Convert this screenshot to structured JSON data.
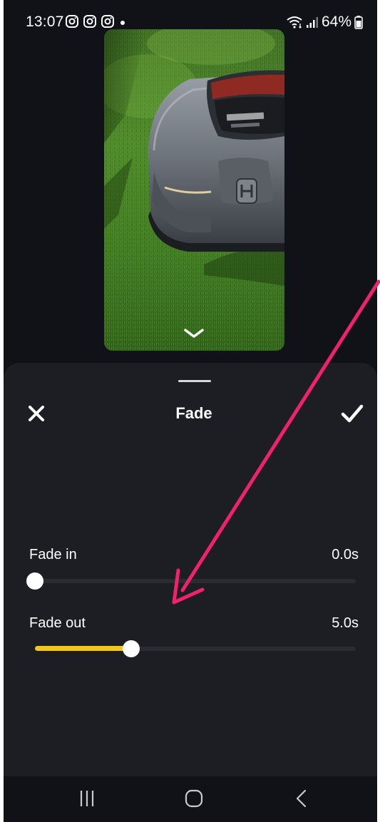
{
  "status_bar": {
    "time": "13:07",
    "battery": "64%",
    "left_icons": [
      "instagram-icon",
      "instagram-icon",
      "instagram-icon",
      "notification-dot"
    ],
    "right_icons": [
      "wifi-icon",
      "signal-icon",
      "battery-icon"
    ]
  },
  "preview": {
    "collapse_icon": "chevron-down-icon"
  },
  "sheet": {
    "title": "Fade",
    "close_icon": "close-icon",
    "confirm_icon": "checkmark-icon",
    "sliders": [
      {
        "label": "Fade in",
        "value": "0.0s",
        "fraction": 0.0,
        "color": "#f6c515"
      },
      {
        "label": "Fade out",
        "value": "5.0s",
        "fraction": 0.3,
        "color": "#f6c515"
      }
    ]
  },
  "nav_bar": {
    "icons": [
      "recent-apps-icon",
      "home-icon",
      "back-icon"
    ]
  },
  "colors": {
    "accent": "#f6c515",
    "annotation_arrow": "#f0226a",
    "sheet_bg": "#1d1e23",
    "screen_bg": "#111217"
  }
}
